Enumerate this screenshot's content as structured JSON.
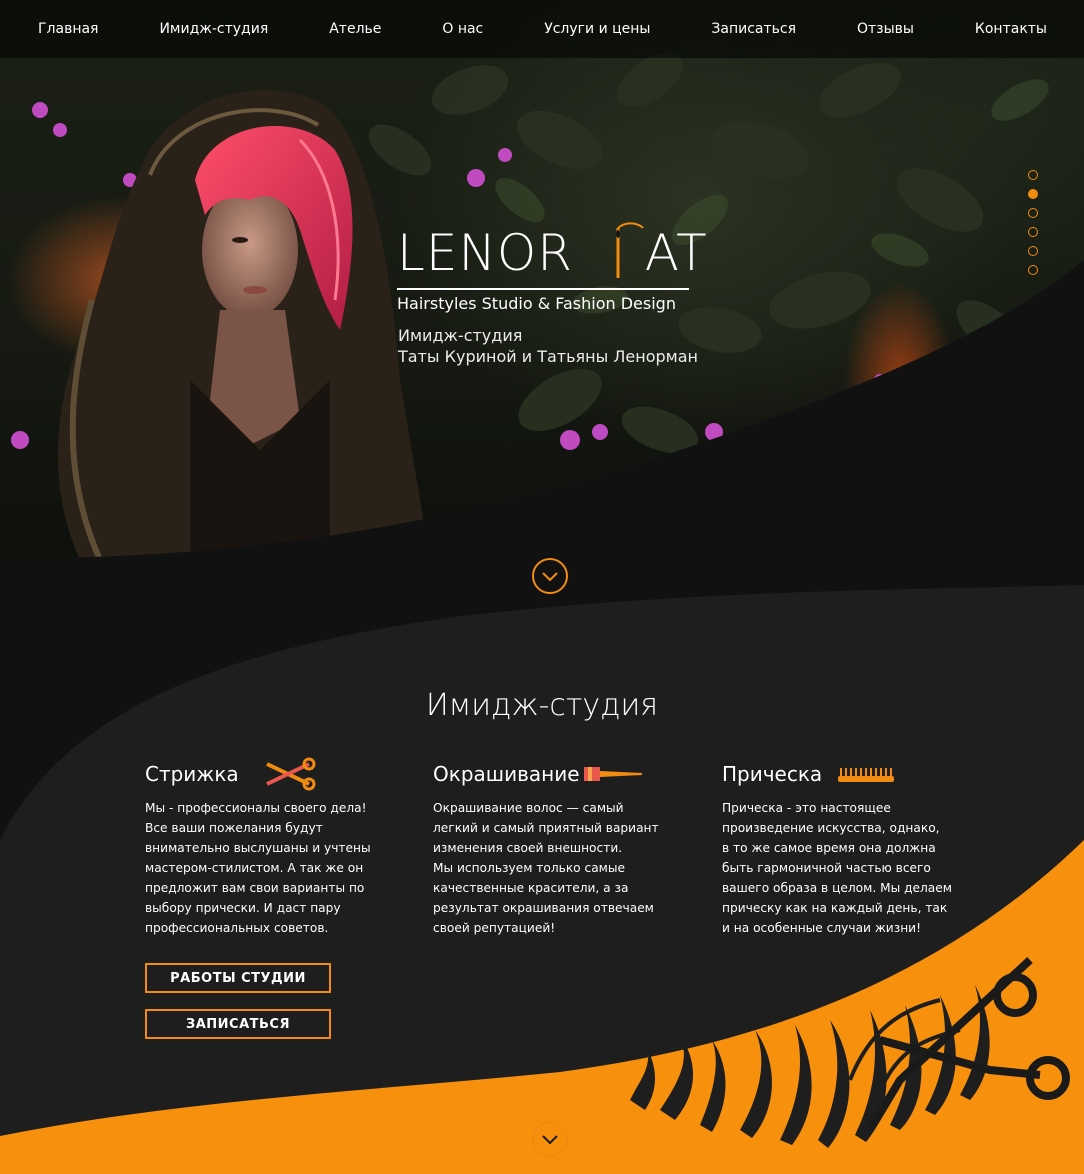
{
  "nav": {
    "items": [
      {
        "label": "Главная"
      },
      {
        "label": "Имидж-студия"
      },
      {
        "label": "Ателье"
      },
      {
        "label": "О нас"
      },
      {
        "label": "Услуги и цены"
      },
      {
        "label": "Записаться"
      },
      {
        "label": "Отзывы"
      },
      {
        "label": "Контакты"
      }
    ]
  },
  "hero": {
    "logo_left": "LENOR",
    "logo_right": "AT",
    "tagline": "Hairstyles Studio  &  Fashion Design",
    "subtitle_line1": "Имидж-студия",
    "subtitle_line2": "Таты Куриной и Татьяны Ленорман",
    "slides_total": 6,
    "slide_active": 2
  },
  "studio": {
    "title": "Имидж-студия",
    "columns": [
      {
        "title": "Стрижка",
        "icon": "scissors-icon",
        "text": "Мы - профессионалы своего дела!\nВсе ваши пожелания будут\nвнимательно выслушаны и учтены\nмастером-стилистом. А так же он\nпредложит вам свои варианты по\nвыбору прически. И даст пару\nпрофессиональных советов."
      },
      {
        "title": "Окрашивание",
        "icon": "dye-brush-icon",
        "text": "Окрашивание волос — самый\nлегкий и самый приятный вариант\nизменения своей внешности.\nМы используем только самые\nкачественные красители, а за\nрезультат окрашивания отвечаем\nсвоей репутацией!"
      },
      {
        "title": "Прическа",
        "icon": "comb-icon",
        "text": "Прическа - это настоящее\nпроизведение искусства, однако,\nв то же самое время она должна\nбыть гармоничной частью всего\nвашего образа в целом. Мы делаем\nприческу как на каждый день, так\nи на особенные случаи жизни!"
      }
    ],
    "works_button": "РАБОТЫ СТУДИИ",
    "book_button": "ЗАПИСАТЬСЯ"
  },
  "colors": {
    "accent": "#f28c10",
    "dark": "#111111",
    "panel": "#1e1e1e"
  }
}
